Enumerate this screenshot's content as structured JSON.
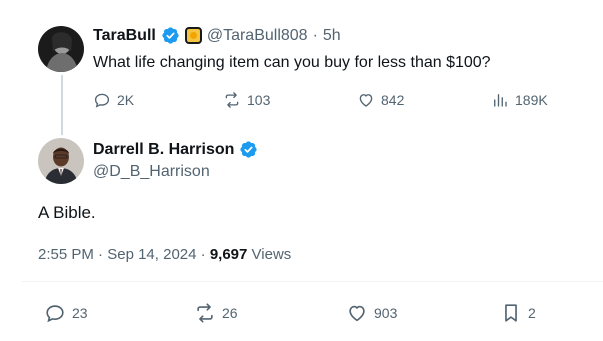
{
  "parent_tweet": {
    "display_name": "TaraBull",
    "handle": "@TaraBull808",
    "separator": "·",
    "time_ago": "5h",
    "text": "What life changing item can you buy for less than $100?",
    "stats": {
      "replies": "2K",
      "reposts": "103",
      "likes": "842",
      "views": "189K"
    }
  },
  "main_tweet": {
    "display_name": "Darrell B. Harrison",
    "handle": "@D_B_Harrison",
    "text": "A Bible.",
    "time": "2:55 PM",
    "separator": "·",
    "date": "Sep 14, 2024",
    "view_count": "9,697",
    "views_label": "Views",
    "stats": {
      "replies": "23",
      "reposts": "26",
      "likes": "903",
      "bookmarks": "2"
    }
  },
  "colors": {
    "verified_blue": "#1d9bf0",
    "muted_text": "#536471",
    "primary_text": "#0f1419",
    "thread_line": "#cfd9de"
  },
  "icons": {
    "reply": "reply-icon",
    "repost": "repost-icon",
    "like": "heart-icon",
    "views": "views-bar-chart-icon",
    "bookmark": "bookmark-icon",
    "verified": "verified-badge-icon",
    "affiliate": "gold-affiliate-badge-icon"
  }
}
